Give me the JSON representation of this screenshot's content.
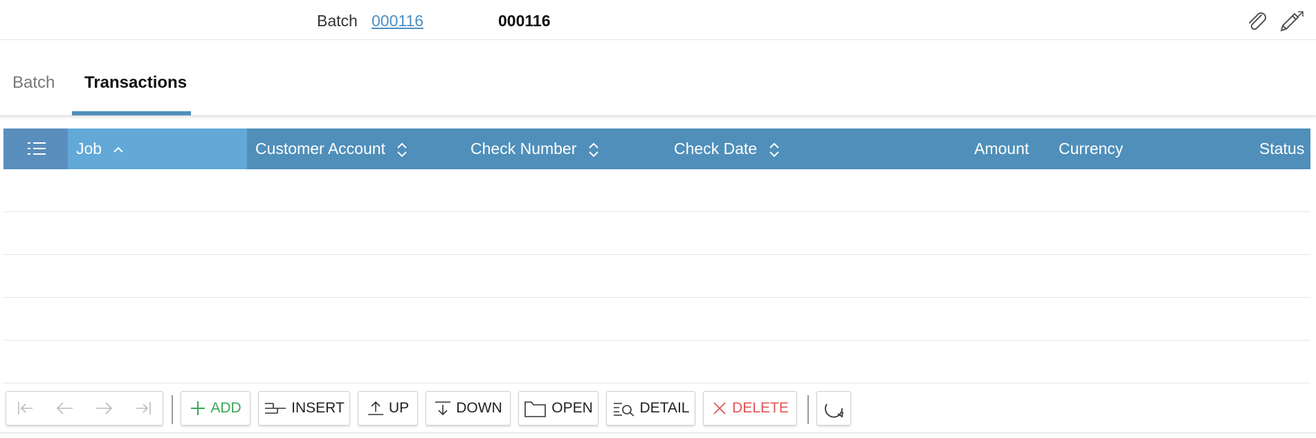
{
  "header": {
    "batch_label": "Batch",
    "batch_link": "000116",
    "batch_value": "000116",
    "icons": [
      "paperclip-icon",
      "edit-expand-icon"
    ]
  },
  "tabs": [
    {
      "label": "Batch",
      "active": false
    },
    {
      "label": "Transactions",
      "active": true
    }
  ],
  "grid": {
    "columns": [
      {
        "label": "Job",
        "sort": "ascending"
      },
      {
        "label": "Customer Account",
        "sort": "sortable"
      },
      {
        "label": "Check Number",
        "sort": "sortable"
      },
      {
        "label": "Check Date",
        "sort": "sortable"
      },
      {
        "label": "Amount",
        "sort": "none"
      },
      {
        "label": "Currency",
        "sort": "none"
      },
      {
        "label": "Status",
        "sort": "none"
      }
    ],
    "rows": []
  },
  "toolbar": {
    "add": "ADD",
    "insert": "INSERT",
    "up": "UP",
    "down": "DOWN",
    "open": "OPEN",
    "detail": "DETAIL",
    "delete": "DELETE"
  },
  "colors": {
    "header_bg": "#4f8fba",
    "active_column_bg": "#62a9d8",
    "link": "#4a8fc4",
    "add": "#3aa655",
    "delete": "#e05555"
  }
}
